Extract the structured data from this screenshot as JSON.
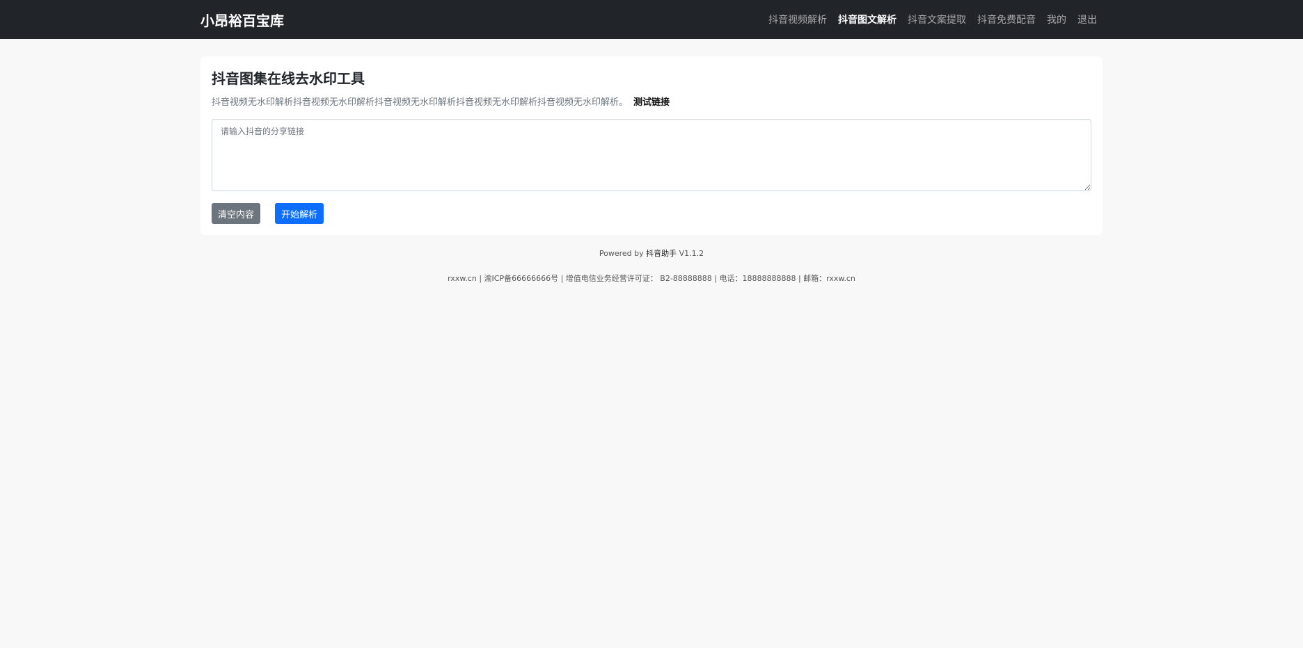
{
  "navbar": {
    "brand": "小昂裕百宝库",
    "links": [
      {
        "label": "抖音视频解析",
        "active": false
      },
      {
        "label": "抖音图文解析",
        "active": true
      },
      {
        "label": "抖音文案提取",
        "active": false
      },
      {
        "label": "抖音免费配音",
        "active": false
      },
      {
        "label": "我的",
        "active": false
      },
      {
        "label": "退出",
        "active": false
      }
    ]
  },
  "card": {
    "title": "抖音图集在线去水印工具",
    "description": "抖音视频无水印解析抖音视频无水印解析抖音视频无水印解析抖音视频无水印解析抖音视频无水印解析。",
    "test_link": "测试链接",
    "input_placeholder": "请输入抖音的分享链接",
    "input_value": "",
    "clear_button": "清空内容",
    "parse_button": "开始解析"
  },
  "footer": {
    "powered_prefix": "Powered by",
    "powered_name": "抖音助手",
    "version": "V1.1.2",
    "info": "rxxw.cn | 渝ICP备66666666号 | 增值电信业务经营许可证： B2-88888888 | 电话：18888888888 | 邮箱：rxxw.cn"
  },
  "colors": {
    "navbar_bg": "#212529",
    "page_bg": "#f8f8f8",
    "primary": "#0d6efd",
    "secondary": "#6c757d"
  }
}
